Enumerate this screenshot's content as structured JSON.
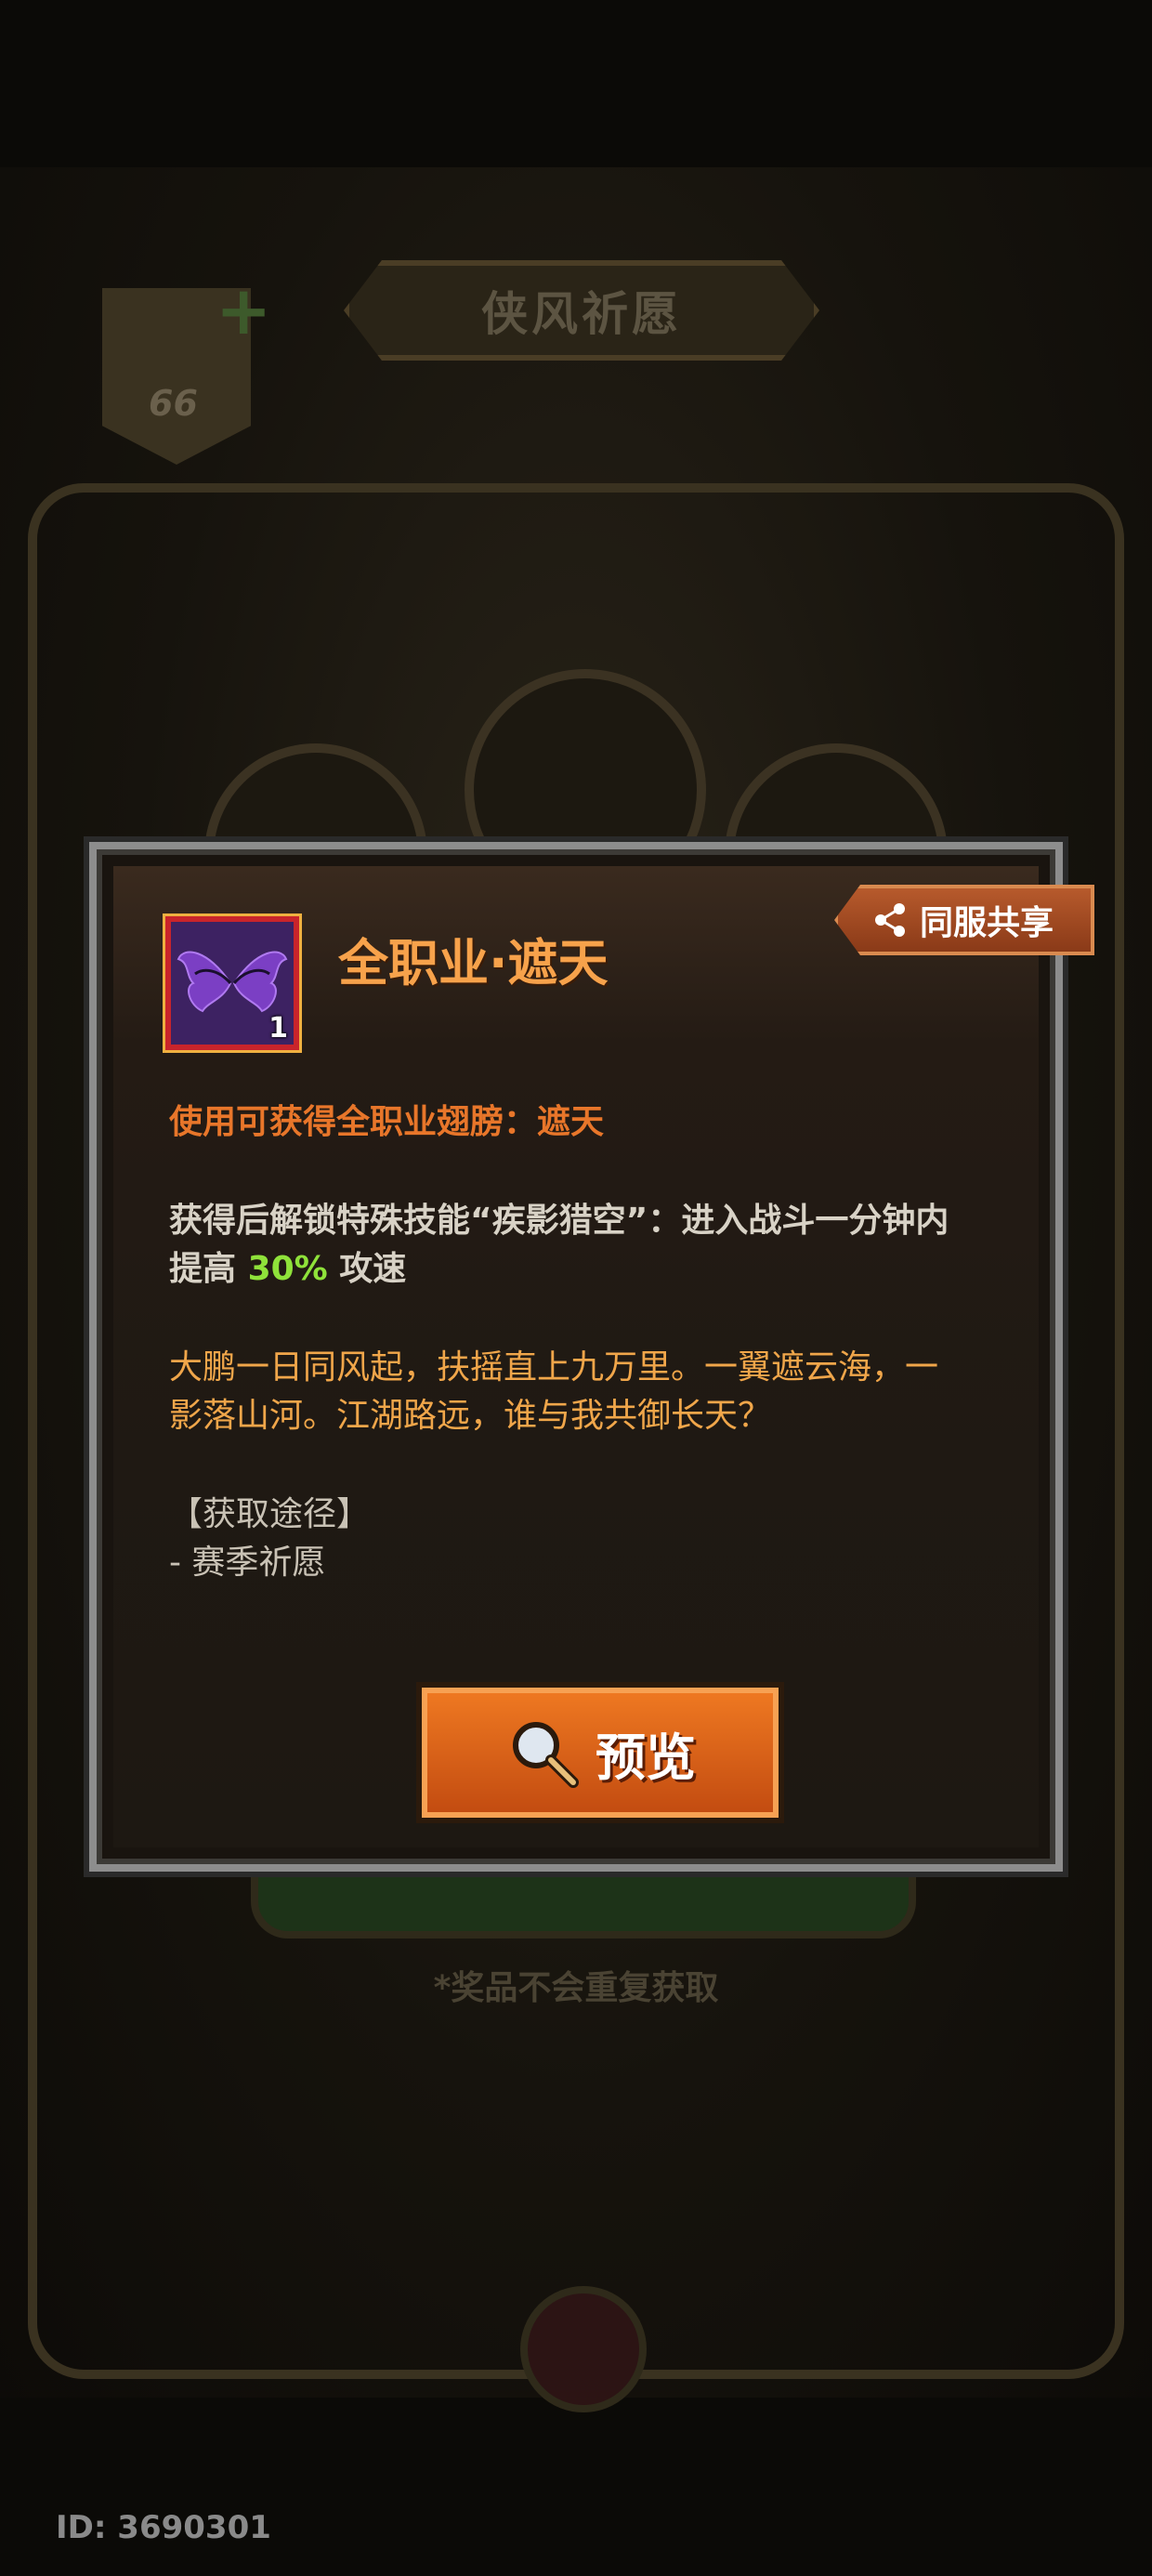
{
  "background": {
    "title": "侠风祈愿",
    "badge_count": "66",
    "note": "*奖品不会重复获取"
  },
  "footer": {
    "id_label": "ID: 3690301"
  },
  "dialog": {
    "item_count": "1",
    "item_title": "全职业·遮天",
    "share_label": "同服共享",
    "use_line": "使用可获得全职业翅膀：遮天",
    "skill_line1": "获得后解锁特殊技能“疾影猎空”：进入战斗一分钟内",
    "skill_line2_prefix": "提高",
    "skill_percent": "30%",
    "skill_line2_suffix": "攻速",
    "flavor_line1": "大鹏一日同风起，扶摇直上九万里。一翼遮云海，一",
    "flavor_line2": "影落山河。江湖路远，谁与我共御长天？",
    "source_header": "【获取途径】",
    "source_item": "- 赛季祈愿",
    "preview_label": "预览"
  },
  "colors": {
    "title_orange": "#f7a24b",
    "desc_orange": "#e8762a",
    "highlight_green": "#8fe23a",
    "button_orange": "#e0661a"
  }
}
